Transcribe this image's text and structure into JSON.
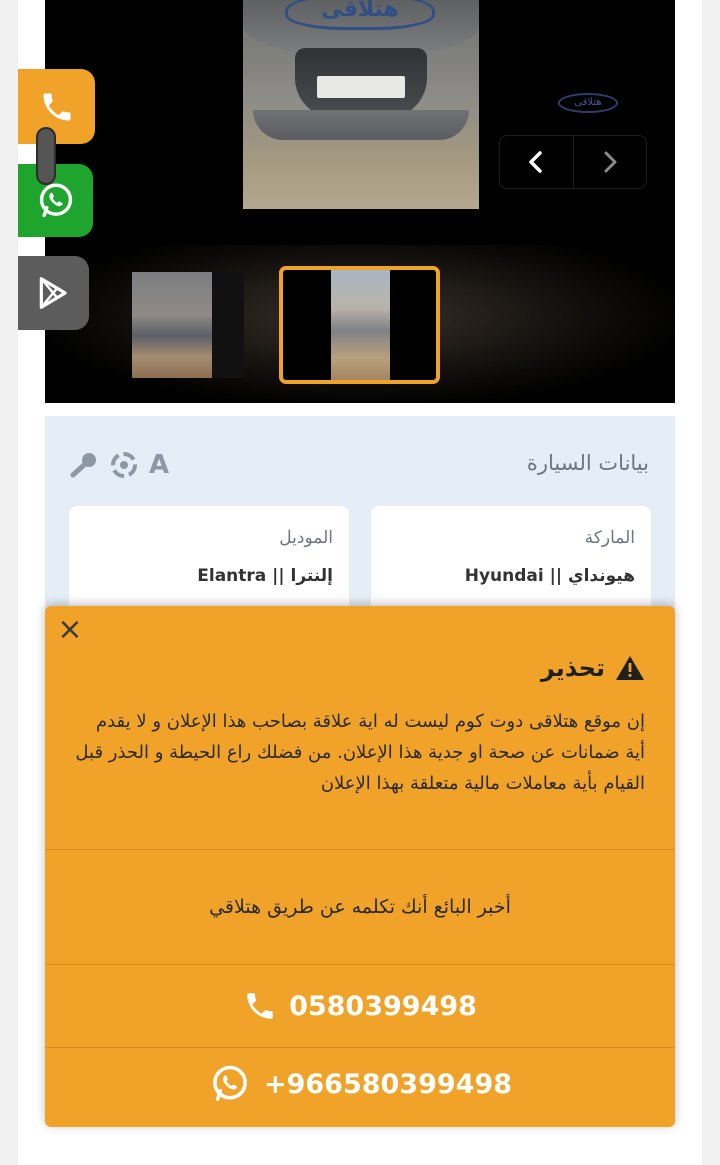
{
  "gallery": {
    "watermark_text": "هتلاقى",
    "watermark_small_text": "هتلاقى",
    "prev_label": "‹",
    "next_label": "›"
  },
  "side_buttons": {
    "phone_icon": "phone-icon",
    "whatsapp_icon": "whatsapp-icon",
    "store_icon": "play-store-icon"
  },
  "car_data": {
    "title": "بيانات السيارة",
    "tools_letter": "A",
    "brand_label": "الماركة",
    "brand_value": "هيونداي || Hyundai",
    "model_label": "الموديل",
    "model_value": "إلنترا || Elantra"
  },
  "warning": {
    "close_label": "×",
    "title": "تحذير",
    "body": "إن موقع هتلاقى دوت كوم ليست له اية علاقة بصاحب هذا الإعلان و لا يقدم أية ضمانات عن صحة او جدية هذا الإعلان. من فضلك راع الحيطة و الحذر قبل القيام بأية معاملات مالية متعلقة بهذا الإعلان",
    "tell_seller": "أخبر البائع أنك تكلمه عن طريق هتلاقي",
    "phone_number": "0580399498",
    "whatsapp_number": "+966580399498"
  },
  "colors": {
    "accent": "#f0a328",
    "whatsapp": "#1fa52e",
    "panel_bg": "#e5edf7"
  }
}
